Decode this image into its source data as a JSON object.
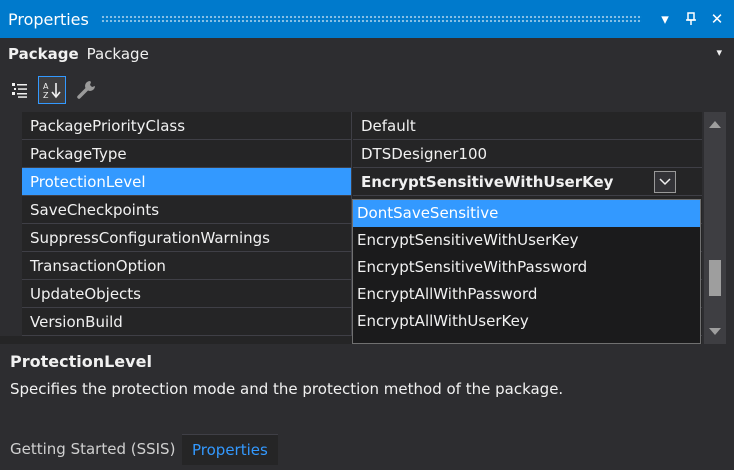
{
  "window": {
    "title": "Properties",
    "buttons": {
      "menu": "▾",
      "pin": "⊥",
      "close": "✕"
    }
  },
  "object_selector": {
    "name": "Package",
    "type": "Package",
    "arrow": "▾"
  },
  "toolbar": {
    "icons": [
      "categorized-icon",
      "alphabetical-sort-icon",
      "property-pages-icon"
    ]
  },
  "properties": [
    {
      "name": "PackagePriorityClass",
      "value": "Default"
    },
    {
      "name": "PackageType",
      "value": "DTSDesigner100"
    },
    {
      "name": "ProtectionLevel",
      "value": "EncryptSensitiveWithUserKey",
      "selected": true
    },
    {
      "name": "SaveCheckpoints",
      "value": ""
    },
    {
      "name": "SuppressConfigurationWarnings",
      "value": ""
    },
    {
      "name": "TransactionOption",
      "value": ""
    },
    {
      "name": "UpdateObjects",
      "value": ""
    },
    {
      "name": "VersionBuild",
      "value": ""
    }
  ],
  "dropdown": {
    "options": [
      "DontSaveSensitive",
      "EncryptSensitiveWithUserKey",
      "EncryptSensitiveWithPassword",
      "EncryptAllWithPassword",
      "EncryptAllWithUserKey"
    ],
    "highlighted": "DontSaveSensitive"
  },
  "description": {
    "title": "ProtectionLevel",
    "text": "Specifies the protection mode and the protection method of the package."
  },
  "tabs": [
    {
      "label": "Getting Started (SSIS)",
      "active": false
    },
    {
      "label": "Properties",
      "active": true
    }
  ],
  "colors": {
    "accent": "#007acc",
    "selection": "#3399ff",
    "background": "#2d2d30"
  }
}
